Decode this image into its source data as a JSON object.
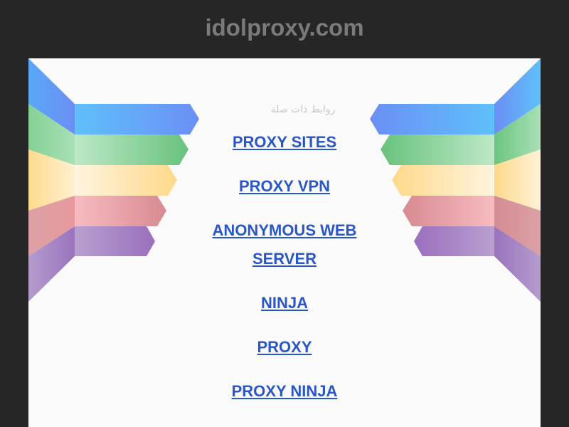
{
  "header": {
    "title": "idolproxy.com"
  },
  "main": {
    "related_caption": "روابط ذات صلة",
    "links": [
      {
        "label": "PROXY SITES"
      },
      {
        "label": "PROXY VPN"
      },
      {
        "label": "ANONYMOUS WEB SERVER"
      },
      {
        "label": "NINJA"
      },
      {
        "label": "PROXY"
      },
      {
        "label": "PROXY NINJA"
      }
    ]
  },
  "colors": {
    "background": "#262626",
    "panel": "#fafafa",
    "title": "#7a7a7a",
    "link": "#2a56c6",
    "ribbon_blue": "#5aa7f7",
    "ribbon_green": "#7dcc8d",
    "ribbon_yellow": "#fde4a6",
    "ribbon_red": "#eaa7aa",
    "ribbon_purple": "#a587c4"
  }
}
